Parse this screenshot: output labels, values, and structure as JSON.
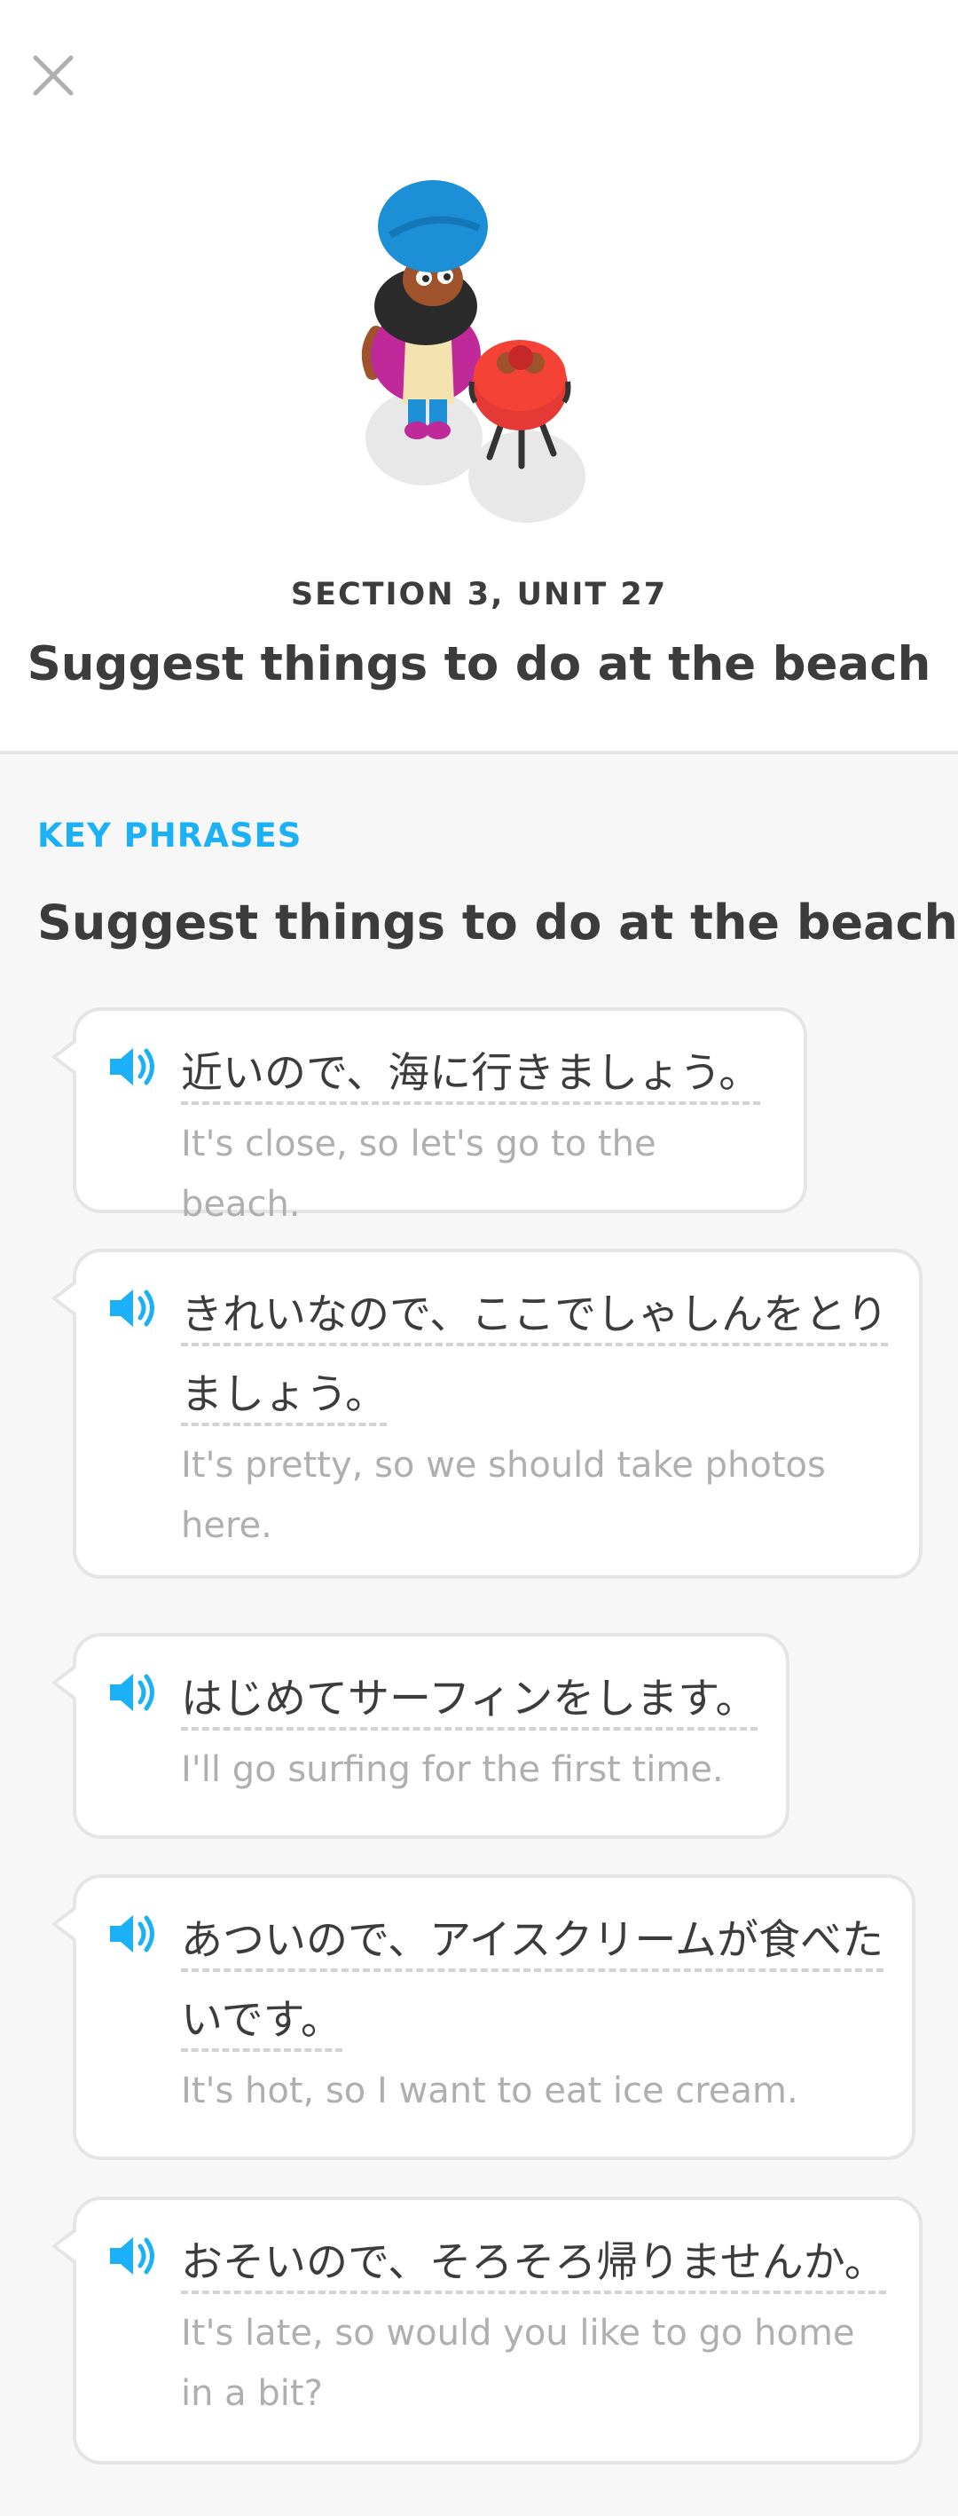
{
  "header": {
    "section_label": "SECTION 3, UNIT 27",
    "title": "Suggest things to do at the beach"
  },
  "tips": {
    "label": "KEY PHRASES",
    "title": "Suggest things to do at the beach",
    "phrases": [
      {
        "jp": "近いので、海に行きましょう。",
        "en": "It's close, so let's go to the beach."
      },
      {
        "jp": "きれいなので、ここでしゃしんをとりましょう。",
        "en": "It's pretty, so we should take photos here."
      },
      {
        "jp": "はじめてサーフィンをします。",
        "en": "I'll go surfing for the first time."
      },
      {
        "jp": "あついので、アイスクリームが食べたいです。",
        "en": "It's hot, so I want to eat ice cream."
      },
      {
        "jp": "おそいので、そろそろ帰りませんか。",
        "en": "It's late, so would you like to go home in a bit?"
      }
    ]
  },
  "colors": {
    "accent": "#1cb0f6",
    "text": "#3c3c3c",
    "muted": "#afafaf",
    "border": "#e5e5e5",
    "background": "#f7f7f7"
  },
  "icons": {
    "close": "close-icon",
    "speaker": "speaker-icon"
  }
}
